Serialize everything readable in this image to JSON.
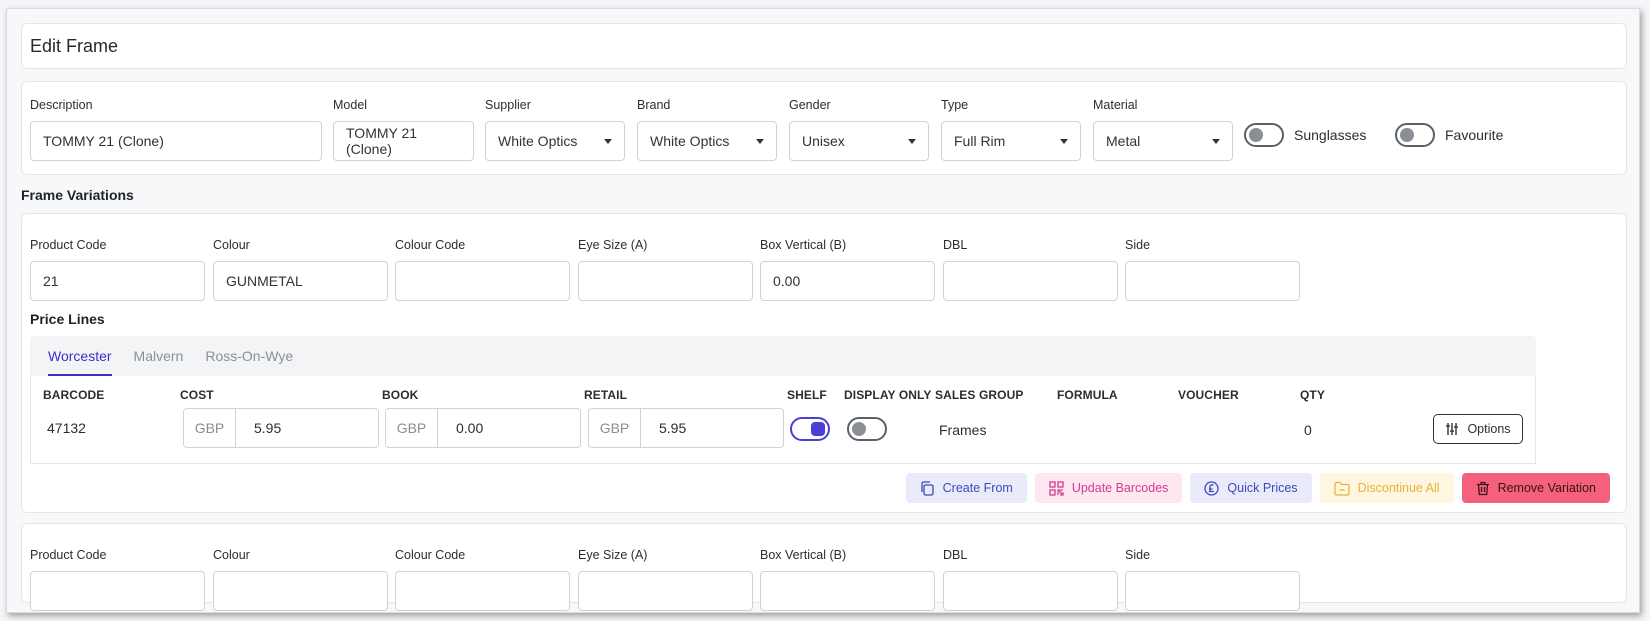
{
  "page_title": "Edit Frame",
  "frame": {
    "description_label": "Description",
    "description_value": "TOMMY 21 (Clone)",
    "model_label": "Model",
    "model_value": "TOMMY 21 (Clone)",
    "supplier_label": "Supplier",
    "supplier_value": "White Optics",
    "brand_label": "Brand",
    "brand_value": "White Optics",
    "gender_label": "Gender",
    "gender_value": "Unisex",
    "type_label": "Type",
    "type_value": "Full Rim",
    "material_label": "Material",
    "material_value": "Metal",
    "sunglasses_label": "Sunglasses",
    "sunglasses_on": false,
    "favourite_label": "Favourite",
    "favourite_on": false
  },
  "variations_heading": "Frame Variations",
  "variation_labels": {
    "product_code": "Product Code",
    "colour": "Colour",
    "colour_code": "Colour Code",
    "eye_size": "Eye Size (A)",
    "box_vertical": "Box Vertical (B)",
    "dbl": "DBL",
    "side": "Side"
  },
  "variation1": {
    "product_code": "21",
    "colour": "GUNMETAL",
    "colour_code": "",
    "eye_size": "",
    "box_vertical": "0.00",
    "dbl": "",
    "side": ""
  },
  "price_lines_heading": "Price Lines",
  "tabs": [
    "Worcester",
    "Malvern",
    "Ross-On-Wye"
  ],
  "price_headers": {
    "barcode": "BARCODE",
    "cost": "COST",
    "book": "BOOK",
    "retail": "RETAIL",
    "shelf": "SHELF",
    "display_only": "DISPLAY ONLY",
    "sales_group": "SALES GROUP",
    "formula": "FORMULA",
    "voucher": "VOUCHER",
    "qty": "QTY"
  },
  "price_row": {
    "barcode": "47132",
    "cost_currency": "GBP",
    "cost": "5.95",
    "book_currency": "GBP",
    "book": "0.00",
    "retail_currency": "GBP",
    "retail": "5.95",
    "shelf_on": true,
    "display_only_on": false,
    "sales_group": "Frames",
    "formula": "",
    "voucher": "",
    "qty": "0",
    "options_label": "Options"
  },
  "actions": {
    "create_from": "Create From",
    "update_barcodes": "Update Barcodes",
    "quick_prices": "Quick Prices",
    "discontinue_all": "Discontinue All",
    "remove_variation": "Remove Variation"
  },
  "colors": {
    "accent": "#3b30c8",
    "danger": "#f5617a",
    "pink": "#d63a8a",
    "amber": "#e8b23a"
  }
}
